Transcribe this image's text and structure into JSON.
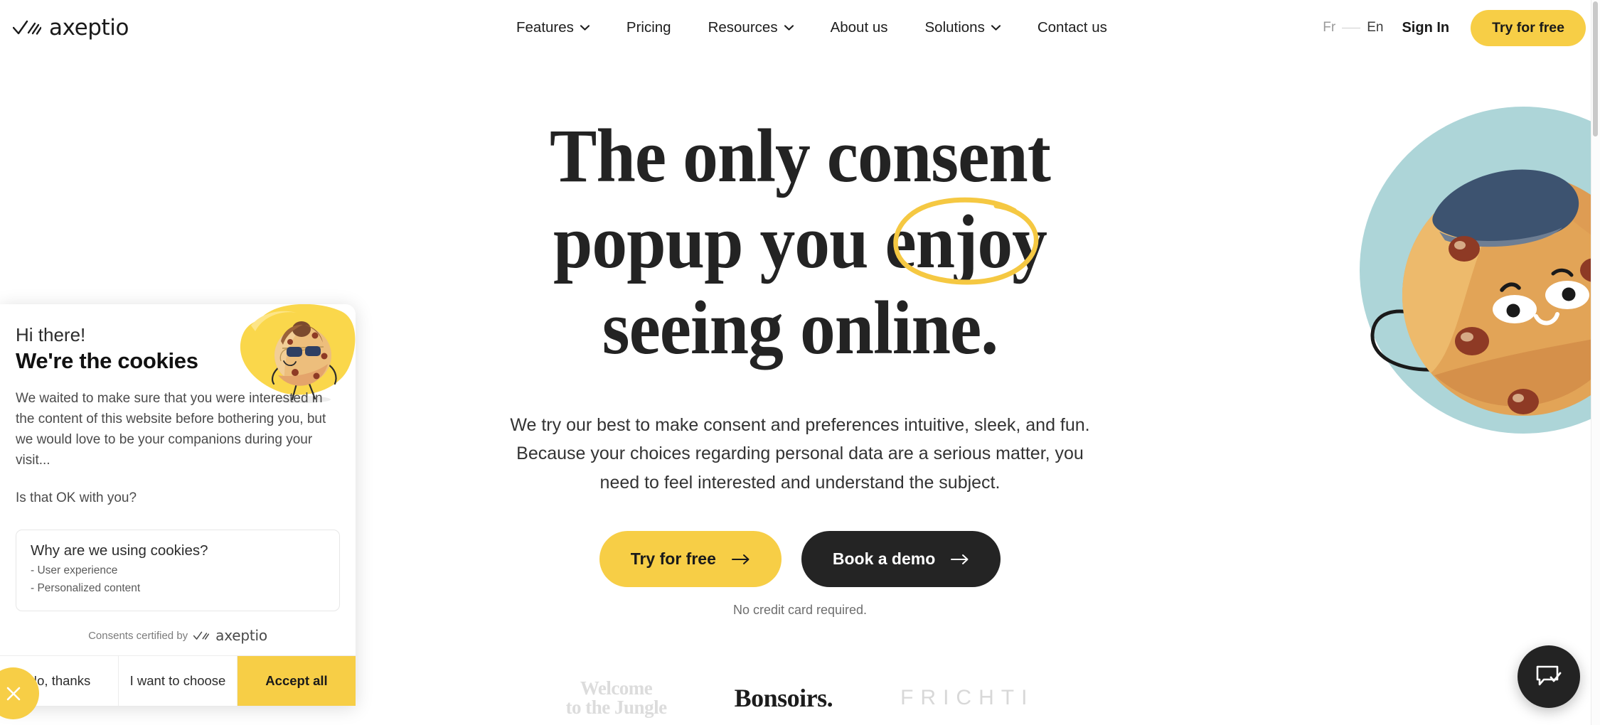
{
  "brand": {
    "name": "axeptio",
    "accent_yellow": "#F7CE46",
    "dark": "#232323"
  },
  "header": {
    "logo_text": "axeptio",
    "nav": [
      {
        "label": "Features",
        "has_dropdown": true
      },
      {
        "label": "Pricing",
        "has_dropdown": false
      },
      {
        "label": "Resources",
        "has_dropdown": true
      },
      {
        "label": "About us",
        "has_dropdown": false
      },
      {
        "label": "Solutions",
        "has_dropdown": true
      },
      {
        "label": "Contact us",
        "has_dropdown": false
      }
    ],
    "lang_fr": "Fr",
    "lang_en": "En",
    "sign_in": "Sign In",
    "try_for_free": "Try for free"
  },
  "hero": {
    "headline_line1": "The only consent",
    "headline_line2_pre": "popup you ",
    "headline_line2_highlight": "enjoy",
    "headline_line3": "seeing online.",
    "subtitle_line1": "We try our best to make consent and preferences intuitive, sleek, and fun.",
    "subtitle_line2": "Because your choices regarding personal data are a serious matter, you",
    "subtitle_line3": "need to feel interested and understand the subject.",
    "cta_primary": "Try for free",
    "cta_secondary": "Book a demo",
    "note": "No credit card required."
  },
  "partners": [
    {
      "name": "Welcome to the Jungle",
      "line1": "Welcome",
      "line2": "to the Jungle"
    },
    {
      "name": "Bonsoirs.",
      "line1": "Bonsoirs."
    },
    {
      "name": "FRICHTI",
      "line1": "FRICHTI"
    }
  ],
  "cookie_widget": {
    "greeting": "Hi there!",
    "title": "We're the cookies",
    "paragraph": "We waited to make sure that you were interested in the content of this website before bothering you, but we would love to be your companions during your visit...",
    "question": "Is that OK with you?",
    "box_title": "Why are we using cookies?",
    "box_items": [
      "- User experience",
      "- Personalized content"
    ],
    "certified_text": "Consents certified by",
    "certified_brand": "axeptio",
    "buttons": {
      "decline": "No, thanks",
      "choose": "I want to choose",
      "accept": "Accept all"
    }
  },
  "floating": {
    "close_label": "close-widget",
    "chat_label": "chat-widget"
  }
}
